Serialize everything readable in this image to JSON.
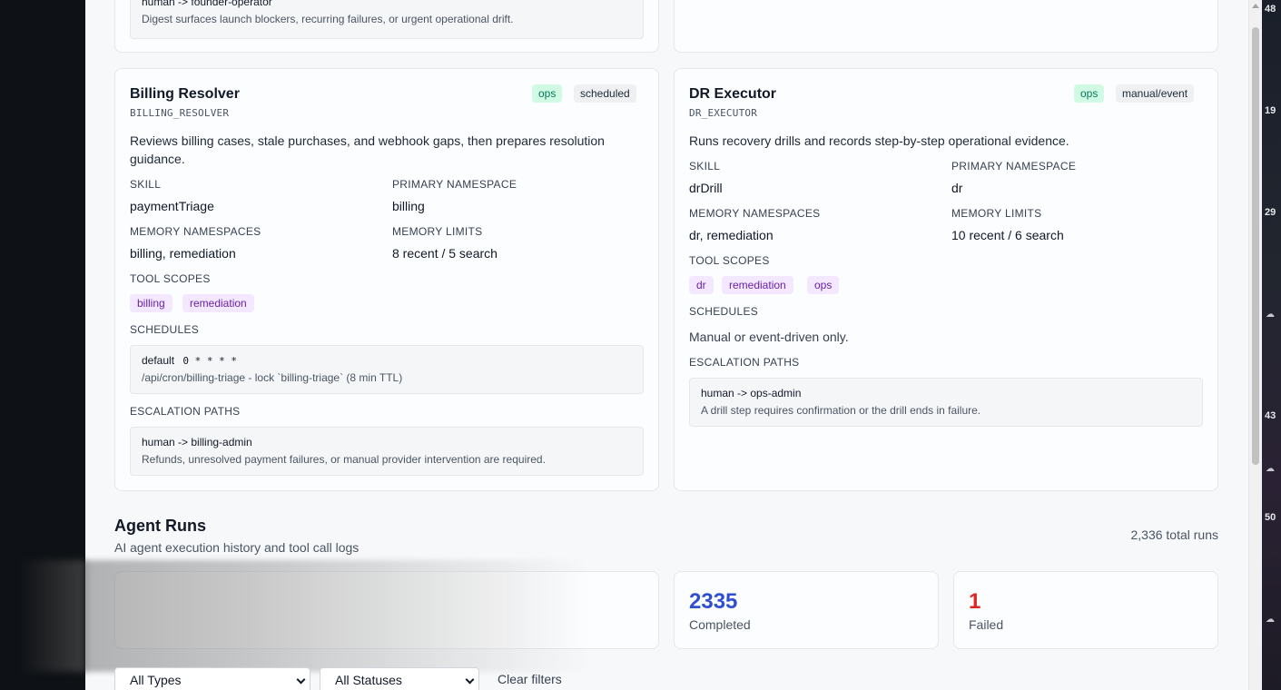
{
  "top_card": {
    "escalation_title": "human -> founder-operator",
    "escalation_desc": "Digest surfaces launch blockers, recurring failures, or urgent operational drift."
  },
  "agents": [
    {
      "name": "Billing Resolver",
      "code": "BILLING_RESOLVER",
      "badges": [
        "ops",
        "scheduled"
      ],
      "description": "Reviews billing cases, stale purchases, and webhook gaps, then prepares resolution guidance.",
      "skill_label": "SKILL",
      "skill": "paymentTriage",
      "primary_ns_label": "PRIMARY NAMESPACE",
      "primary_ns": "billing",
      "memory_ns_label": "MEMORY NAMESPACES",
      "memory_ns": "billing, remediation",
      "memory_limits_label": "MEMORY LIMITS",
      "memory_limits": "8 recent / 5 search",
      "tool_scopes_label": "TOOL SCOPES",
      "tool_scopes": [
        "billing",
        "remediation"
      ],
      "schedules_label": "SCHEDULES",
      "schedule_name": "default",
      "schedule_cron": "0 * * * *",
      "schedule_detail": "/api/cron/billing-triage - lock `billing-triage` (8 min TTL)",
      "escalation_label": "ESCALATION PATHS",
      "escalation_title": "human -> billing-admin",
      "escalation_desc": "Refunds, unresolved payment failures, or manual provider intervention are required."
    },
    {
      "name": "DR Executor",
      "code": "DR_EXECUTOR",
      "badges": [
        "ops",
        "manual/event"
      ],
      "description": "Runs recovery drills and records step-by-step operational evidence.",
      "skill_label": "SKILL",
      "skill": "drDrill",
      "primary_ns_label": "PRIMARY NAMESPACE",
      "primary_ns": "dr",
      "memory_ns_label": "MEMORY NAMESPACES",
      "memory_ns": "dr, remediation",
      "memory_limits_label": "MEMORY LIMITS",
      "memory_limits": "10 recent / 6 search",
      "tool_scopes_label": "TOOL SCOPES",
      "tool_scopes": [
        "dr",
        "remediation",
        "ops"
      ],
      "schedules_label": "SCHEDULES",
      "schedules_text": "Manual or event-driven only.",
      "escalation_label": "ESCALATION PATHS",
      "escalation_title": "human -> ops-admin",
      "escalation_desc": "A drill step requires confirmation or the drill ends in failure."
    }
  ],
  "runs": {
    "title": "Agent Runs",
    "subtitle": "AI agent execution history and tool call logs",
    "total": "2,336 total runs",
    "completed_value": "2335",
    "completed_label": "Completed",
    "failed_value": "1",
    "failed_label": "Failed",
    "type_filter": "All Types",
    "status_filter": "All Statuses",
    "clear_label": "Clear filters"
  },
  "right_strip_numbers": [
    "48",
    "19",
    "29",
    "43",
    "50"
  ],
  "colors": {
    "completed": "#2f4fd1",
    "failed": "#dc2626",
    "badge_ops_bg": "#d1fae5",
    "chip_bg": "#f3e8ff"
  }
}
